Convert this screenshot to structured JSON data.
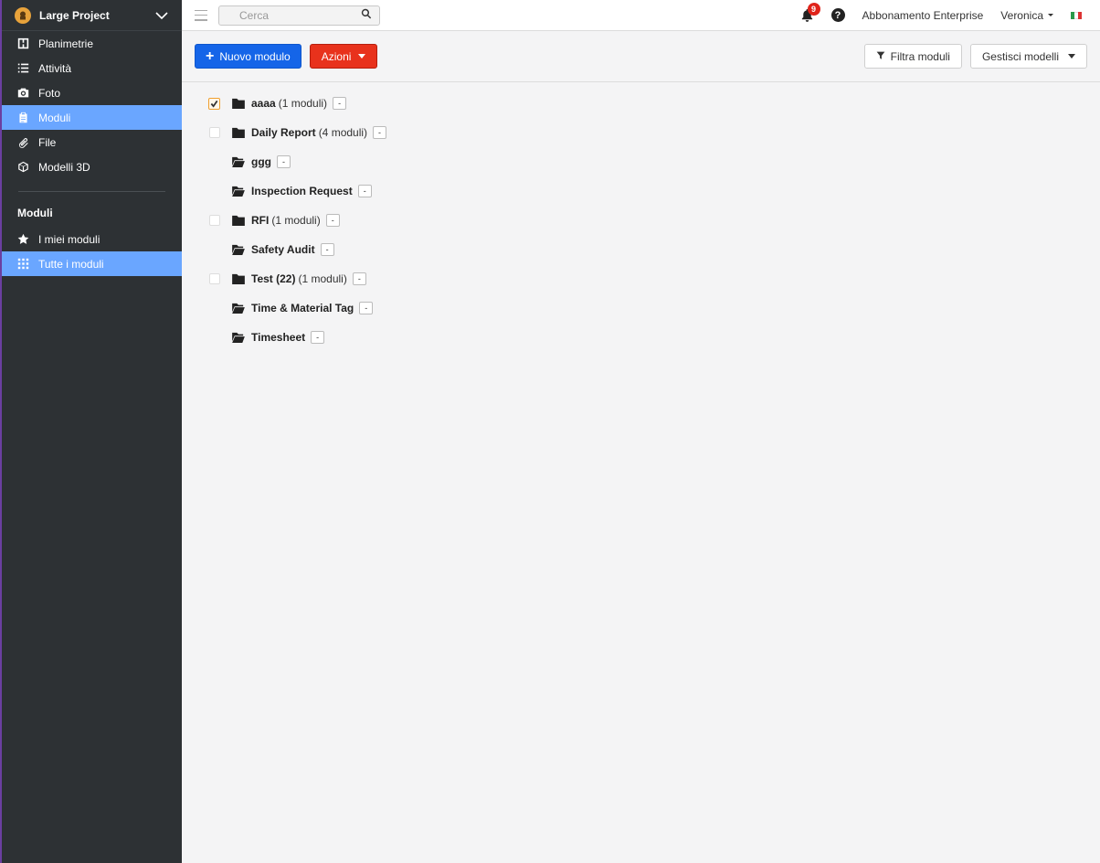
{
  "sidebar": {
    "project_name": "Large Project",
    "nav": [
      {
        "label": "Planimetrie",
        "icon": "floorplan-icon",
        "active": false
      },
      {
        "label": "Attività",
        "icon": "list-icon",
        "active": false
      },
      {
        "label": "Foto",
        "icon": "camera-icon",
        "active": false
      },
      {
        "label": "Moduli",
        "icon": "clipboard-icon",
        "active": true
      },
      {
        "label": "File",
        "icon": "paperclip-icon",
        "active": false
      },
      {
        "label": "Modelli 3D",
        "icon": "cube-icon",
        "active": false
      }
    ],
    "section_title": "Moduli",
    "section_items": [
      {
        "label": "I miei moduli",
        "icon": "star-icon",
        "active": false
      },
      {
        "label": "Tutte i moduli",
        "icon": "grid-icon",
        "active": true
      }
    ]
  },
  "topbar": {
    "search_placeholder": "Cerca",
    "notification_count": "9",
    "subscription_label": "Abbonamento Enterprise",
    "user_name": "Veronica",
    "language_flag": "italy-flag-icon"
  },
  "toolbar": {
    "new_module_label": "Nuovo modulo",
    "actions_label": "Azioni",
    "filter_label": "Filtra moduli",
    "manage_label": "Gestisci modelli"
  },
  "tree": [
    {
      "label": "aaaa",
      "count": "(1 moduli)",
      "type": "folder",
      "checkbox": "checked"
    },
    {
      "label": "Daily Report",
      "count": "(4 moduli)",
      "type": "folder",
      "checkbox": "unchecked"
    },
    {
      "label": "ggg",
      "count": "",
      "type": "folder-open",
      "checkbox": "none"
    },
    {
      "label": "Inspection Request",
      "count": "",
      "type": "folder-open",
      "checkbox": "none"
    },
    {
      "label": "RFI",
      "count": "(1 moduli)",
      "type": "folder",
      "checkbox": "unchecked"
    },
    {
      "label": "Safety Audit",
      "count": "",
      "type": "folder-open",
      "checkbox": "none"
    },
    {
      "label": "Test (22)",
      "count": "(1 moduli)",
      "type": "folder",
      "checkbox": "unchecked"
    },
    {
      "label": "Time & Material Tag",
      "count": "",
      "type": "folder-open",
      "checkbox": "none"
    },
    {
      "label": "Timesheet",
      "count": "",
      "type": "folder-open",
      "checkbox": "none"
    }
  ],
  "tree_toggle_symbol": "-",
  "colors": {
    "sidebar_bg": "#2d3134",
    "active_nav": "#6aa6ff",
    "primary": "#1565e8",
    "danger": "#e8321c",
    "badge": "#e0241b"
  }
}
